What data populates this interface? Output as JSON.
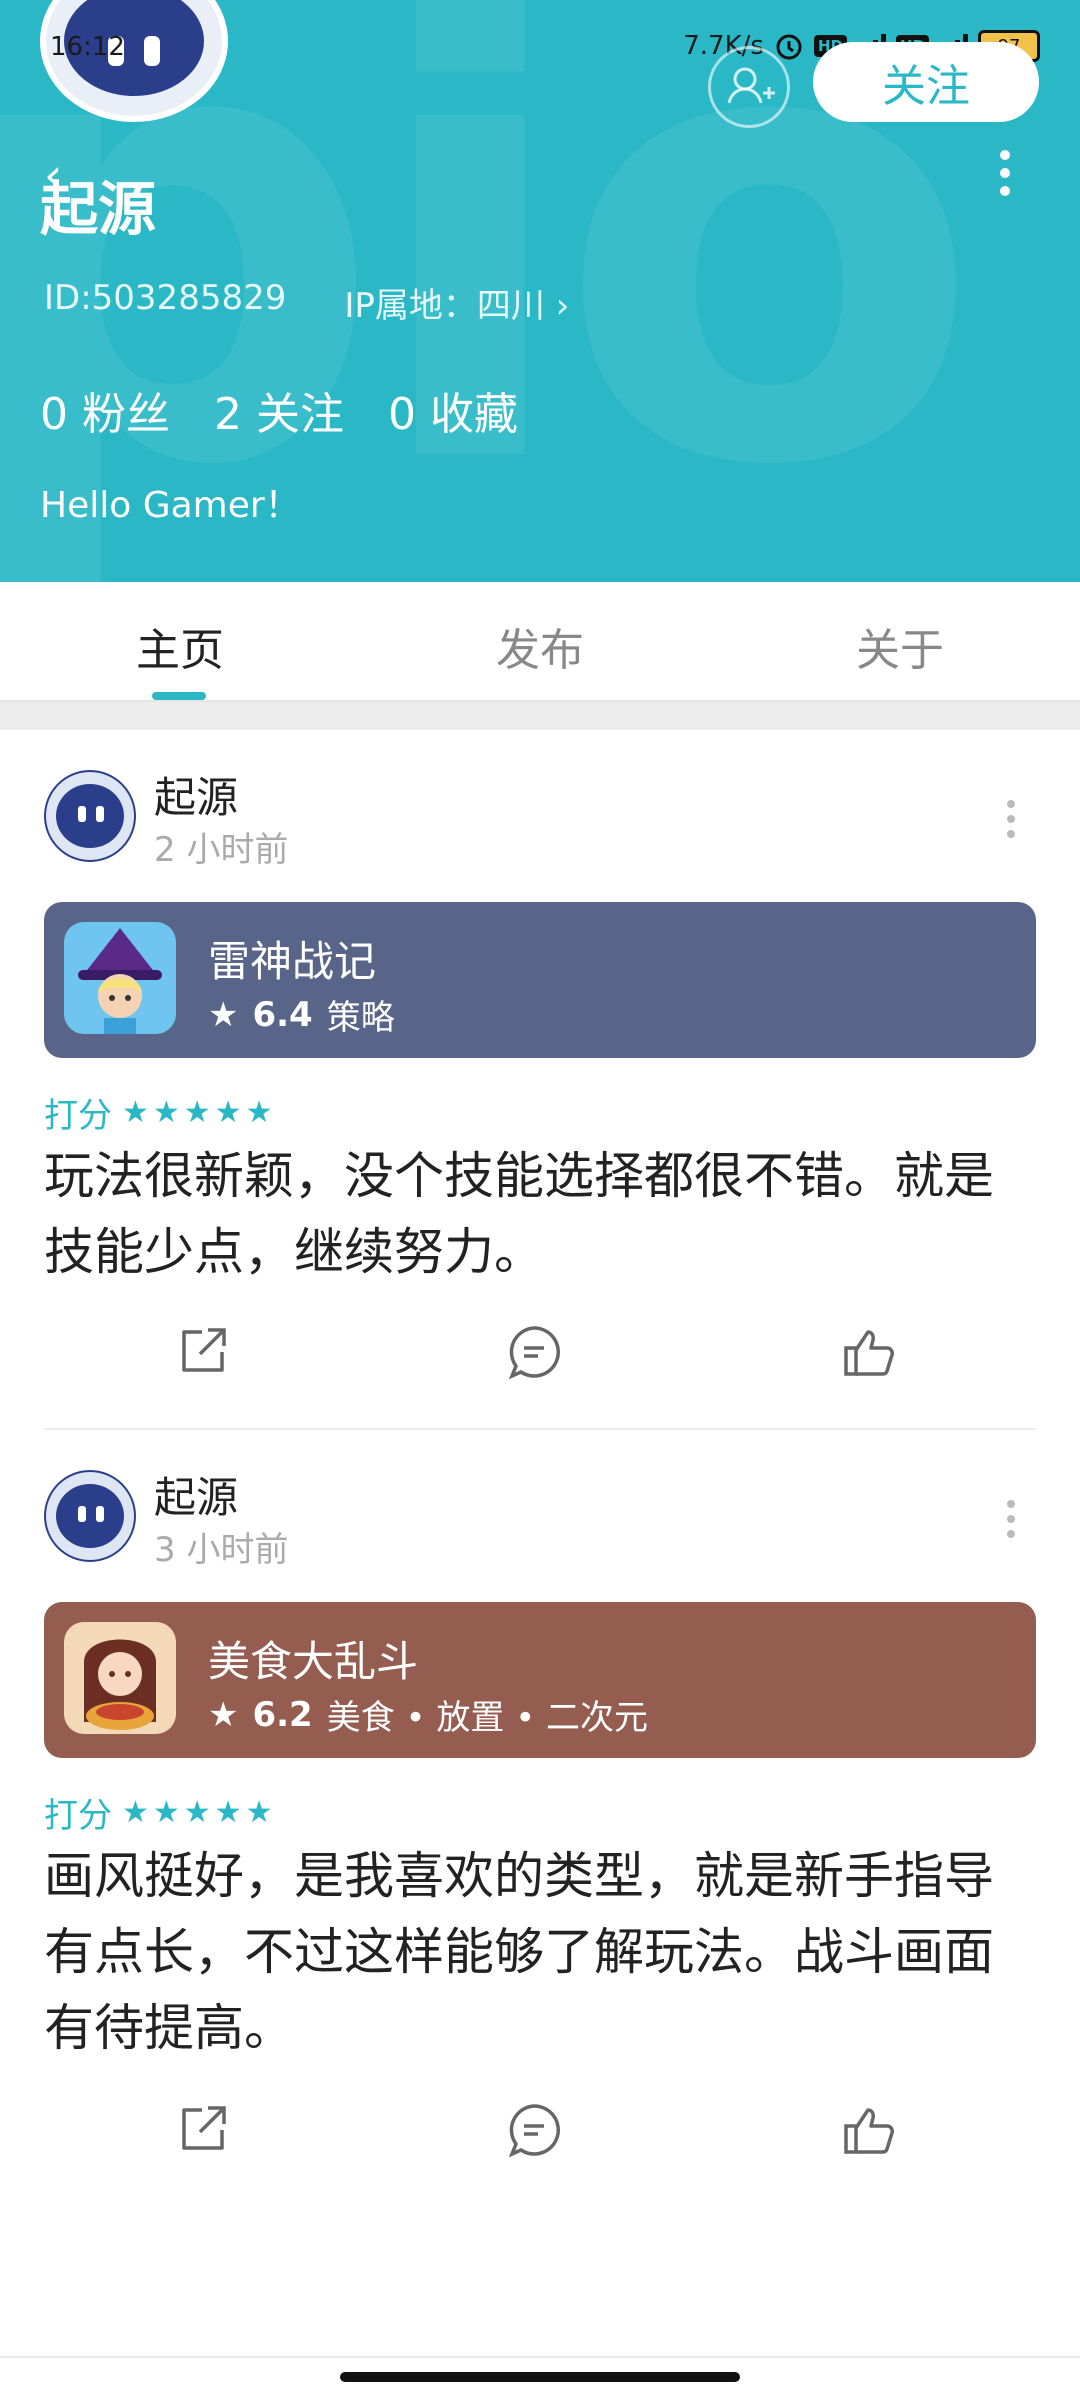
{
  "status_bar": {
    "time": "16:12",
    "network_speed": "7.7K/s",
    "battery": "97"
  },
  "profile": {
    "name": "起源",
    "id_text": "ID:503285829",
    "ip_text": "IP属地：四川",
    "follow_label": "关注",
    "stats": [
      {
        "value": "0",
        "label": "粉丝"
      },
      {
        "value": "2",
        "label": "关注"
      },
      {
        "value": "0",
        "label": "收藏"
      }
    ],
    "bio": "Hello Gamer！"
  },
  "tabs": [
    {
      "label": "主页",
      "active": true
    },
    {
      "label": "发布",
      "active": false
    },
    {
      "label": "关于",
      "active": false
    }
  ],
  "posts": [
    {
      "author": "起源",
      "time": "2 小时前",
      "game": {
        "title": "雷神战记",
        "score": "6.4",
        "tags": "策略",
        "card_color": "#586589"
      },
      "rating_label": "打分",
      "stars": 5,
      "content": "玩法很新颖，没个技能选择都很不错。就是技能少点，继续努力。"
    },
    {
      "author": "起源",
      "time": "3 小时前",
      "game": {
        "title": "美食大乱斗",
        "score": "6.2",
        "tags": "美食 • 放置 • 二次元",
        "card_color": "#945d4f"
      },
      "rating_label": "打分",
      "stars": 5,
      "content": "画风挺好，是我喜欢的类型，就是新手指导有点长，不过这样能够了解玩法。战斗画面有待提高。"
    }
  ],
  "icons": {
    "share": "share-icon",
    "comment": "comment-icon",
    "like": "thumbs-up-icon"
  },
  "accent_color": "#2ab8c6"
}
